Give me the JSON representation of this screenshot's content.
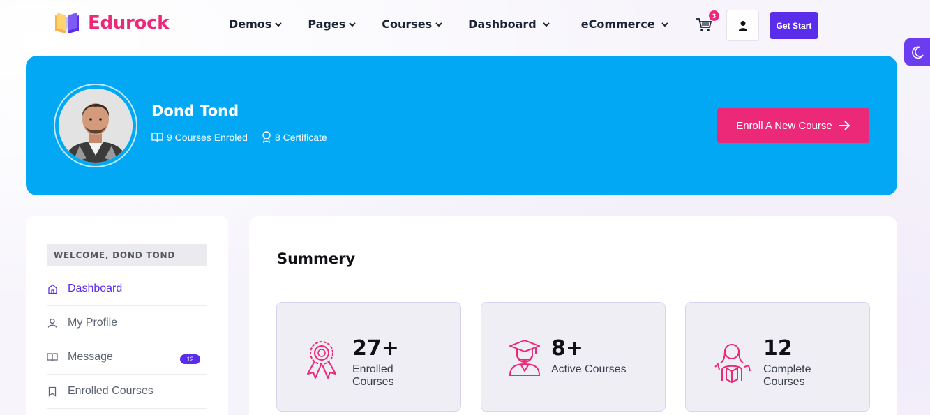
{
  "brand": {
    "name": "Edurock",
    "accent": "#ec2878",
    "primary": "#5a2dea",
    "banner_color": "#03a8f4"
  },
  "nav": {
    "items": [
      {
        "label": "Demos"
      },
      {
        "label": "Pages"
      },
      {
        "label": "Courses"
      },
      {
        "label": "Dashboard"
      },
      {
        "label": "eCommerce"
      }
    ]
  },
  "header": {
    "cart_count": "3",
    "get_start_label": "Get Start",
    "cart_icon": "cart-icon",
    "user_icon": "user-icon",
    "theme_icon": "moon-icon"
  },
  "profile": {
    "name": "Dond Tond",
    "courses_enrolled": "9 Courses Enroled",
    "certificates": "8 Certificate",
    "enroll_button": "Enroll A New Course"
  },
  "sidebar": {
    "welcome": "WELCOME, DOND TOND",
    "items": [
      {
        "label": "Dashboard",
        "icon": "home-icon",
        "active": true
      },
      {
        "label": "My Profile",
        "icon": "user-icon"
      },
      {
        "label": "Message",
        "icon": "book-open-icon",
        "badge": "12"
      },
      {
        "label": "Enrolled Courses",
        "icon": "bookmark-icon"
      }
    ]
  },
  "summary": {
    "title": "Summery",
    "stats": [
      {
        "value": "27+",
        "label": "Enrolled Courses",
        "icon": "award-icon"
      },
      {
        "value": "8+",
        "label": "Active Courses",
        "icon": "graduate-icon"
      },
      {
        "value": "12",
        "label": "Complete Courses",
        "icon": "student-reading-icon"
      }
    ]
  }
}
